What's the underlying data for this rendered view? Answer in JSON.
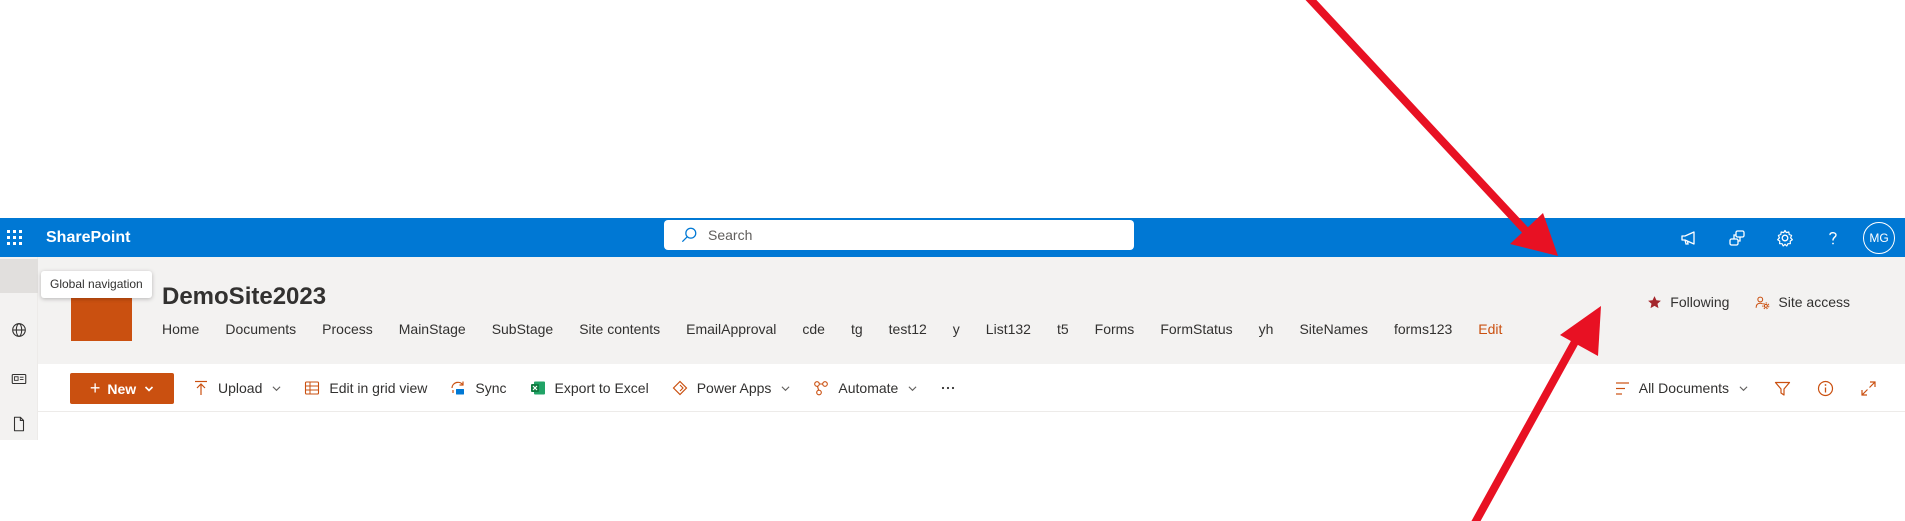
{
  "suitebar": {
    "brand": "SharePoint",
    "search_placeholder": "Search",
    "avatar_initials": "MG",
    "icons": [
      "megaphone-icon",
      "share-connect-icon",
      "gear-icon",
      "help-icon"
    ]
  },
  "tooltip": {
    "text": "Global navigation"
  },
  "site": {
    "title": "DemoSite2023",
    "nav": [
      "Home",
      "Documents",
      "Process",
      "MainStage",
      "SubStage",
      "Site contents",
      "EmailApproval",
      "cde",
      "tg",
      "test12",
      "y",
      "List132",
      "t5",
      "Forms",
      "FormStatus",
      "yh",
      "SiteNames",
      "forms123"
    ],
    "edit_label": "Edit",
    "following_label": "Following",
    "site_access_label": "Site access"
  },
  "commandbar": {
    "new_label": "New",
    "upload_label": "Upload",
    "grid_label": "Edit in grid view",
    "sync_label": "Sync",
    "export_label": "Export to Excel",
    "powerapps_label": "Power Apps",
    "automate_label": "Automate",
    "view_label": "All Documents"
  },
  "colors": {
    "suite_blue": "#0078d4",
    "accent_orange": "#ca5010",
    "header_gray": "#f3f2f1",
    "arrow_red": "#e81123"
  }
}
